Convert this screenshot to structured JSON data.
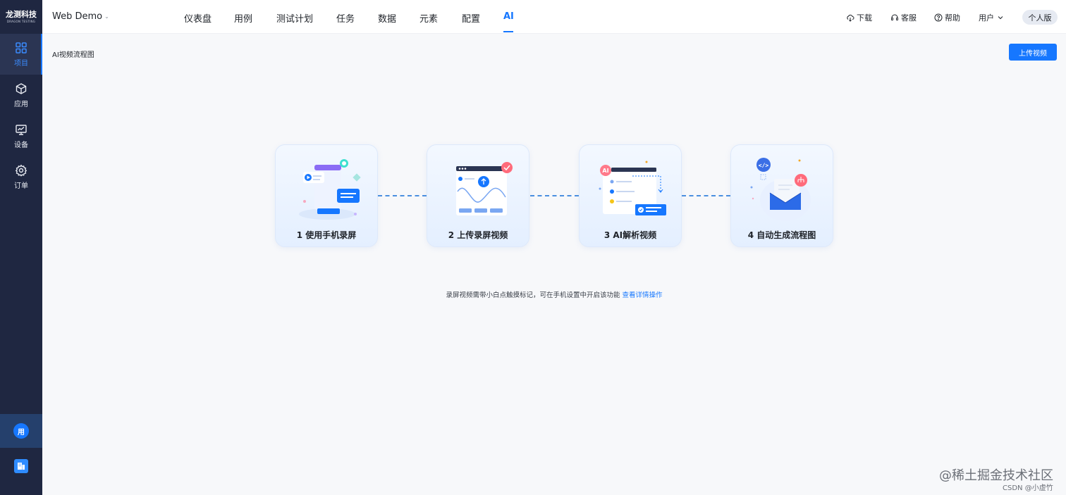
{
  "logo": {
    "main": "龙测科技",
    "sub": "DRAGON TESTING"
  },
  "sidebar": {
    "items": [
      {
        "label": "项目",
        "icon": "grid-icon"
      },
      {
        "label": "应用",
        "icon": "cube-icon"
      },
      {
        "label": "设备",
        "icon": "monitor-icon"
      },
      {
        "label": "订单",
        "icon": "gear-icon"
      }
    ],
    "user_avatar": "用",
    "active": "项目"
  },
  "header": {
    "project": "Web Demo",
    "nav": [
      "仪表盘",
      "用例",
      "测试计划",
      "任务",
      "数据",
      "元素",
      "配置",
      "AI"
    ],
    "active_nav": "AI",
    "download": "下载",
    "service": "客服",
    "help": "帮助",
    "user": "用户",
    "edition": "个人版"
  },
  "page": {
    "title": "AI视频流程图",
    "upload_button": "上传视频"
  },
  "steps": [
    {
      "label": "1 使用手机录屏"
    },
    {
      "label": "2 上传录屏视频"
    },
    {
      "label": "3 AI解析视频"
    },
    {
      "label": "4 自动生成流程图"
    }
  ],
  "hint": {
    "text": "录屏视频需带小白点触摸标记，可在手机设置中开启该功能 ",
    "link": "查看详情操作"
  },
  "watermark": {
    "main": "@稀土掘金技术社区",
    "sub": "CSDN @小虚竹"
  },
  "colors": {
    "accent": "#1677ff",
    "sidebar": "#1f2741"
  }
}
